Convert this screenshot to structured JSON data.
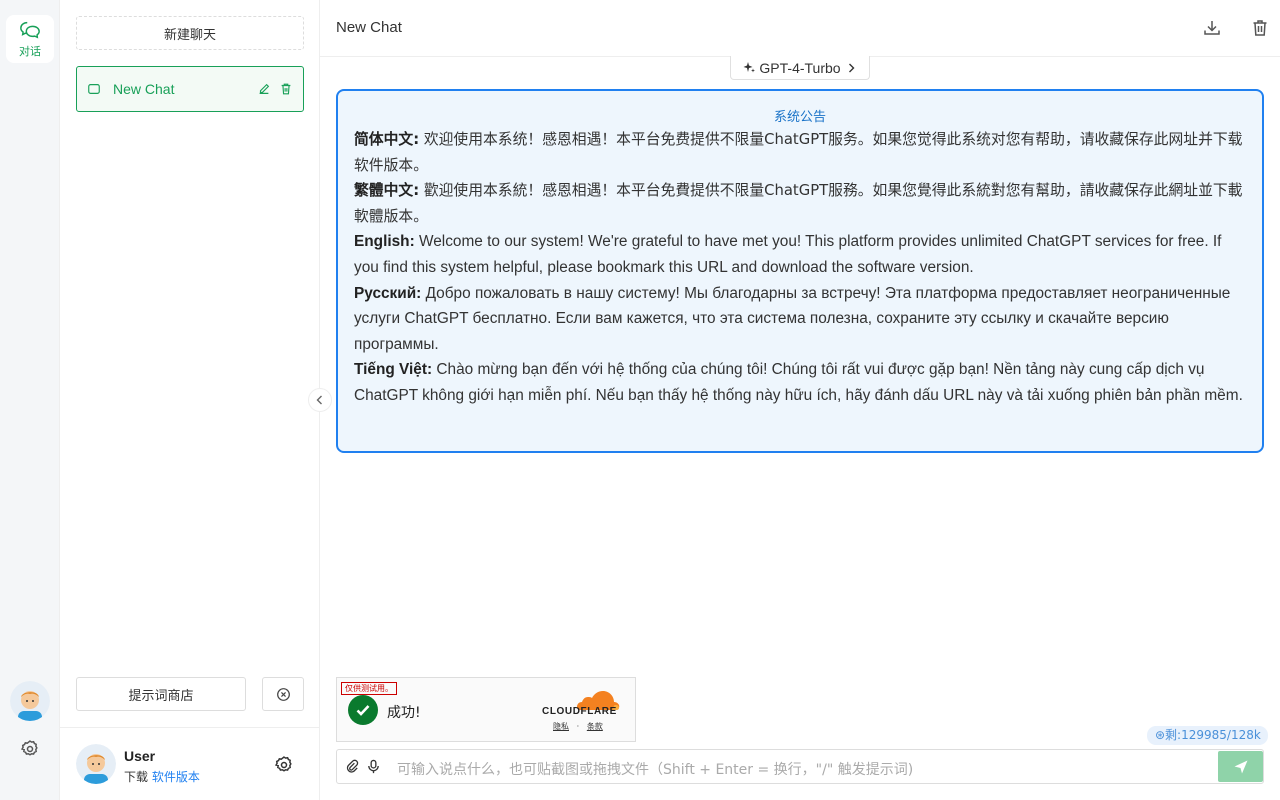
{
  "rail": {
    "chat_tab_label": "对话"
  },
  "sidebar": {
    "new_chat_label": "新建聊天",
    "conversations": [
      {
        "title": "New Chat"
      }
    ],
    "prompt_store_label": "提示词商店",
    "user": {
      "name": "User",
      "download_prefix": "下载",
      "download_link": "软件版本"
    }
  },
  "header": {
    "title": "New Chat"
  },
  "model": {
    "name": "GPT-4-Turbo"
  },
  "notice": {
    "title": "系统公告",
    "items": [
      {
        "lang": "简体中文:",
        "text": " 欢迎使用本系统！感恩相遇！本平台免费提供不限量ChatGPT服务。如果您觉得此系统对您有帮助，请收藏保存此网址并下载软件版本。"
      },
      {
        "lang": "繁體中文:",
        "text": " 歡迎使用本系統！感恩相遇！本平台免費提供不限量ChatGPT服務。如果您覺得此系統對您有幫助，請收藏保存此網址並下載軟體版本。"
      },
      {
        "lang": "English:",
        "text": " Welcome to our system! We're grateful to have met you! This platform provides unlimited ChatGPT services for free. If you find this system helpful, please bookmark this URL and download the software version."
      },
      {
        "lang": "Русский:",
        "text": " Добро пожаловать в нашу систему! Мы благодарны за встречу! Эта платформа предоставляет неограниченные услуги ChatGPT бесплатно. Если вам кажется, что эта система полезна, сохраните эту ссылку и скачайте версию программы."
      },
      {
        "lang": "Tiếng Việt:",
        "text": " Chào mừng bạn đến với hệ thống của chúng tôi! Chúng tôi rất vui được gặp bạn! Nền tảng này cung cấp dịch vụ ChatGPT không giới hạn miễn phí. Nếu bạn thấy hệ thống này hữu ích, hãy đánh dấu URL này và tải xuống phiên bản phần mềm."
      }
    ]
  },
  "captcha": {
    "tag": "仅供测试用。",
    "status": "成功!",
    "brand": "CLOUDFLARE",
    "privacy": "隐私",
    "separator": "·",
    "terms": "条款"
  },
  "tokens": {
    "label": "⊛剩:129985/128k"
  },
  "input": {
    "placeholder": "可输入说点什么，也可贴截图或拖拽文件（Shift + Enter = 换行，\"/\" 触发提示词)"
  },
  "colors": {
    "accent": "#18a058",
    "notice_border": "#2080f0",
    "notice_bg": "#eef6fd",
    "send_button": "#8fd3a9"
  }
}
